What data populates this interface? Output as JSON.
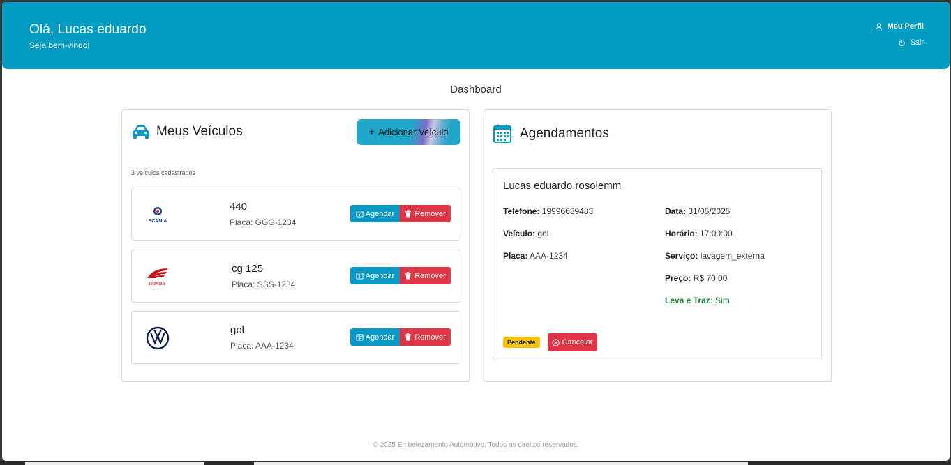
{
  "header": {
    "greeting": "Olá, Lucas eduardo",
    "subtitle": "Seja bem-vindo!",
    "profile_label": "Meu Perfil",
    "logout_label": "Sair",
    "bg_color": "#029cc3"
  },
  "page": {
    "title": "Dashboard"
  },
  "vehicles_panel": {
    "title": "Meus Veículos",
    "add_button": "Adicionar Veículo",
    "count_text": "3 veículos cadastrados",
    "items": [
      {
        "model": "440",
        "plate": "Placa: GGG-1234",
        "brand_icon": "scania-logo",
        "brand_text": "SCANIA",
        "schedule_label": "Agendar",
        "remove_label": "Remover"
      },
      {
        "model": "cg 125",
        "plate": "Placa: SSS-1234",
        "brand_icon": "honda-logo",
        "brand_text": "HONDA",
        "schedule_label": "Agendar",
        "remove_label": "Remover"
      },
      {
        "model": "gol",
        "plate": "Placa: AAA-1234",
        "brand_icon": "volkswagen-logo",
        "schedule_label": "Agendar",
        "remove_label": "Remover"
      }
    ]
  },
  "appointments_panel": {
    "title": "Agendamentos",
    "items": [
      {
        "client": "Lucas eduardo rosolemm",
        "phone_label": "Telefone:",
        "phone": "19996689483",
        "vehicle_label": "Veículo:",
        "vehicle": "gol",
        "plate_label": "Placa:",
        "plate": "AAA-1234",
        "date_label": "Data:",
        "date": "31/05/2025",
        "time_label": "Horário:",
        "time": "17:00:00",
        "service_label": "Serviço:",
        "service": "lavagem_externa",
        "price_label": "Preço:",
        "price": "R$ 70.00",
        "pickup_label": "Leva e Traz:",
        "pickup": "Sim",
        "status": "Pendente",
        "cancel_label": "Cancelar"
      }
    ]
  },
  "footer": {
    "text": "© 2025 Embelezamento Automotivo. Todos os direitos reservados."
  },
  "colors": {
    "primary": "#029cc3",
    "danger": "#dc3545",
    "warning": "#f5c30f",
    "success": "#1e8a3c"
  }
}
